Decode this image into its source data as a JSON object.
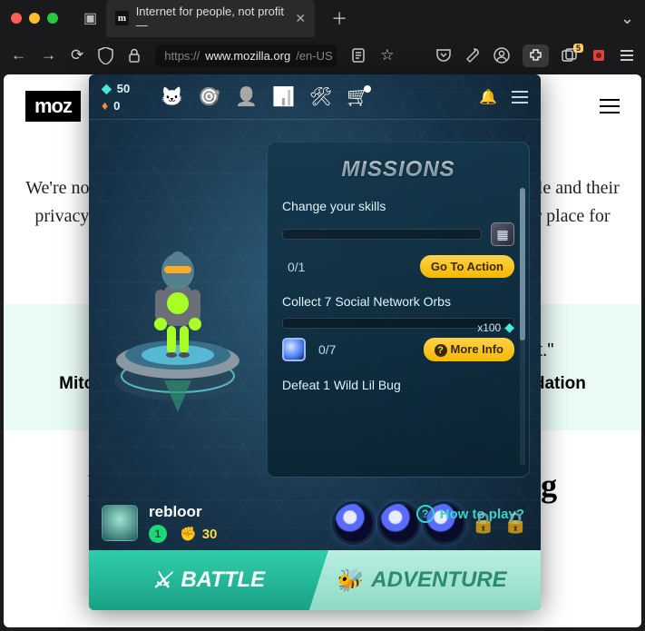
{
  "browser": {
    "tab_title": "Internet for people, not profit —",
    "url_proto": "https://",
    "url_host": "www.mozilla.org",
    "url_path": "/en-US",
    "ext_badge": "5"
  },
  "page": {
    "logo": "moz",
    "hero": "We're not a normal tech company. The things we create prioritize people and their privacy over profits. We exist to make the internet a healthier, happier place for everyone.",
    "quote": "\"The health of the internet and online life is why we exist.\"",
    "quote_attr": "Mitchell Baker, Executive Chair of the Board, Mozilla Foundation",
    "products_h": "Mozilla makes privacy-respecting products"
  },
  "overlay": {
    "currency_gem": "50",
    "currency_dia": "0",
    "missions_title": "MISSIONS",
    "missions": [
      {
        "title": "Change your skills",
        "progress": "0/1",
        "btn": "Go To Action",
        "btn_class": "",
        "reward": ""
      },
      {
        "title": "Collect 7 Social Network Orbs",
        "progress": "0/7",
        "btn": "More Info",
        "btn_class": "info",
        "reward": "x100"
      },
      {
        "title": "Defeat 1 Wild Lil Bug",
        "progress": "",
        "btn": "",
        "btn_class": "",
        "reward": ""
      }
    ],
    "howto": "How to play?",
    "player_name": "rebloor",
    "player_level": "1",
    "player_power": "30",
    "btn_battle": "BATTLE",
    "btn_adventure": "ADVENTURE"
  }
}
